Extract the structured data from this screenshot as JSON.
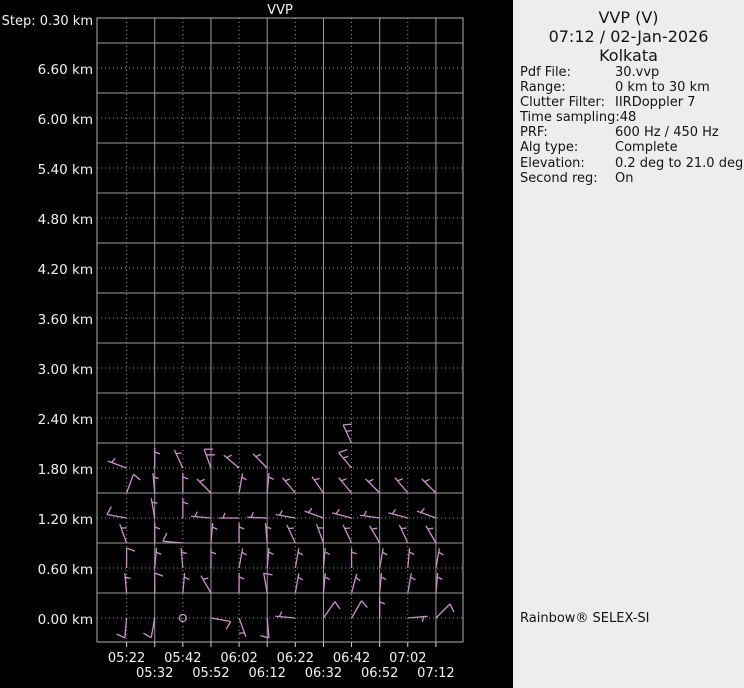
{
  "colors": {
    "background": "#000000",
    "panel_bg": "#ededed",
    "grid": "#9b9b9b",
    "frame": "#b2b2b2",
    "axis_text": "#f2f2f2",
    "barb": "#cf8fcf",
    "panel_text": "#141414"
  },
  "chart": {
    "title": "VVP",
    "step_label": "Step: 0.30 km",
    "y_labels": [
      "6.60 km",
      "6.00 km",
      "5.40 km",
      "4.80 km",
      "4.20 km",
      "3.60 km",
      "3.00 km",
      "2.40 km",
      "1.80 km",
      "1.20 km",
      "0.60 km",
      "0.00 km"
    ],
    "x_labels_row1": [
      "05:22",
      "05:42",
      "06:02",
      "06:22",
      "06:42",
      "07:02"
    ],
    "x_labels_row2": [
      "05:32",
      "05:52",
      "06:12",
      "06:32",
      "06:52",
      "07:12"
    ]
  },
  "chart_data": {
    "type": "wind-barb-time-height-profile",
    "x_times": [
      "05:22",
      "05:32",
      "05:42",
      "05:52",
      "06:02",
      "06:12",
      "06:22",
      "06:32",
      "06:42",
      "06:52",
      "07:02",
      "07:12"
    ],
    "y_heights_km": [
      0.0,
      0.3,
      0.6,
      0.9,
      1.2,
      1.5,
      1.8,
      2.1,
      2.4,
      3.0,
      3.6,
      4.2,
      4.8,
      5.4,
      6.0,
      6.6
    ],
    "y_step_km": 0.3,
    "y_top_km": 7.2,
    "grid": "solid 0.60km/20min major with dotted 0.30km/10min minor",
    "legend_position": "none",
    "barb_format": "[time_index, height_km, direction_deg_from, flags] flags: calm|h(half)|f(full)|fh(full+half)|ff(two full)",
    "barbs": [
      [
        0,
        0.0,
        185,
        "f"
      ],
      [
        1,
        0.0,
        190,
        "f"
      ],
      [
        2,
        0.0,
        0,
        "calm"
      ],
      [
        3,
        0.0,
        100,
        "f"
      ],
      [
        4,
        0.0,
        160,
        "h"
      ],
      [
        5,
        0.0,
        175,
        "f"
      ],
      [
        6,
        0.0,
        275,
        "h"
      ],
      [
        7,
        0.0,
        35,
        "f"
      ],
      [
        8,
        0.0,
        30,
        "f"
      ],
      [
        9,
        0.0,
        0,
        "h"
      ],
      [
        10,
        0.0,
        85,
        "h"
      ],
      [
        11,
        0.0,
        45,
        "f"
      ],
      [
        0,
        0.3,
        355,
        "h"
      ],
      [
        1,
        0.3,
        0,
        "f"
      ],
      [
        2,
        0.3,
        5,
        "h"
      ],
      [
        3,
        0.3,
        330,
        "h"
      ],
      [
        4,
        0.3,
        0,
        "h"
      ],
      [
        5,
        0.3,
        350,
        "f"
      ],
      [
        6,
        0.3,
        10,
        "h"
      ],
      [
        7,
        0.3,
        5,
        "h"
      ],
      [
        8,
        0.3,
        15,
        "h"
      ],
      [
        9,
        0.3,
        5,
        "h"
      ],
      [
        10,
        0.3,
        10,
        "h"
      ],
      [
        11,
        0.3,
        5,
        "h"
      ],
      [
        0,
        0.6,
        0,
        "f"
      ],
      [
        1,
        0.6,
        5,
        "h"
      ],
      [
        2,
        0.6,
        355,
        "h"
      ],
      [
        3,
        0.6,
        0,
        "h"
      ],
      [
        4,
        0.6,
        10,
        "h"
      ],
      [
        5,
        0.6,
        5,
        "h"
      ],
      [
        6,
        0.6,
        10,
        "h"
      ],
      [
        7,
        0.6,
        5,
        "h"
      ],
      [
        8,
        0.6,
        0,
        "h"
      ],
      [
        9,
        0.6,
        10,
        "h"
      ],
      [
        10,
        0.6,
        5,
        "h"
      ],
      [
        11,
        0.6,
        10,
        "h"
      ],
      [
        0,
        0.9,
        340,
        "h"
      ],
      [
        1,
        0.9,
        0,
        "h"
      ],
      [
        2,
        0.9,
        275,
        "f"
      ],
      [
        3,
        0.9,
        5,
        "h"
      ],
      [
        4,
        0.9,
        0,
        "h"
      ],
      [
        5,
        0.9,
        355,
        "h"
      ],
      [
        6,
        0.9,
        335,
        "h"
      ],
      [
        7,
        0.9,
        340,
        "h"
      ],
      [
        8,
        0.9,
        335,
        "h"
      ],
      [
        9,
        0.9,
        330,
        "h"
      ],
      [
        10,
        0.9,
        335,
        "h"
      ],
      [
        11,
        0.9,
        330,
        "h"
      ],
      [
        0,
        1.2,
        280,
        "f"
      ],
      [
        1,
        1.2,
        350,
        "h"
      ],
      [
        2,
        1.2,
        0,
        "h"
      ],
      [
        3,
        1.2,
        275,
        "h"
      ],
      [
        4,
        1.2,
        270,
        "h"
      ],
      [
        5,
        1.2,
        272,
        "h"
      ],
      [
        6,
        1.2,
        280,
        "h"
      ],
      [
        7,
        1.2,
        290,
        "h"
      ],
      [
        8,
        1.2,
        285,
        "h"
      ],
      [
        9,
        1.2,
        278,
        "h"
      ],
      [
        10,
        1.2,
        285,
        "h"
      ],
      [
        11,
        1.2,
        290,
        "h"
      ],
      [
        0,
        1.5,
        20,
        "f"
      ],
      [
        1,
        1.5,
        355,
        "h"
      ],
      [
        2,
        1.5,
        0,
        "h"
      ],
      [
        3,
        1.5,
        315,
        "h"
      ],
      [
        4,
        1.5,
        10,
        "h"
      ],
      [
        5,
        1.5,
        5,
        "h"
      ],
      [
        6,
        1.5,
        320,
        "h"
      ],
      [
        7,
        1.5,
        325,
        "h"
      ],
      [
        8,
        1.5,
        320,
        "h"
      ],
      [
        9,
        1.5,
        315,
        "h"
      ],
      [
        10,
        1.5,
        320,
        "h"
      ],
      [
        11,
        1.5,
        315,
        "h"
      ],
      [
        0,
        1.8,
        290,
        "h"
      ],
      [
        1,
        1.8,
        0,
        "h"
      ],
      [
        2,
        1.8,
        335,
        "h"
      ],
      [
        3,
        1.8,
        340,
        "ff"
      ],
      [
        4,
        1.8,
        310,
        "h"
      ],
      [
        5,
        1.8,
        315,
        "h"
      ],
      [
        8,
        1.8,
        320,
        "fh"
      ],
      [
        8,
        2.1,
        335,
        "fh"
      ]
    ]
  },
  "panel": {
    "title": "VVP (V)",
    "datetime": "07:12 / 02-Jan-2026",
    "site": "Kolkata",
    "params": [
      {
        "label": "Pdf File:",
        "value": "30.vvp"
      },
      {
        "label": "Range:",
        "value": "0 km to 30 km"
      },
      {
        "label": "Clutter Filter:",
        "value": "IIRDoppler 7"
      },
      {
        "label": "Time sampling:",
        "value": "48"
      },
      {
        "label": "PRF:",
        "value": "600 Hz / 450 Hz"
      },
      {
        "label": "Alg type:",
        "value": "Complete"
      },
      {
        "label": "Elevation:",
        "value": "0.2 deg to 21.0 deg"
      },
      {
        "label": "Second reg:",
        "value": "On"
      }
    ],
    "footer": "Rainbow® SELEX-SI"
  }
}
